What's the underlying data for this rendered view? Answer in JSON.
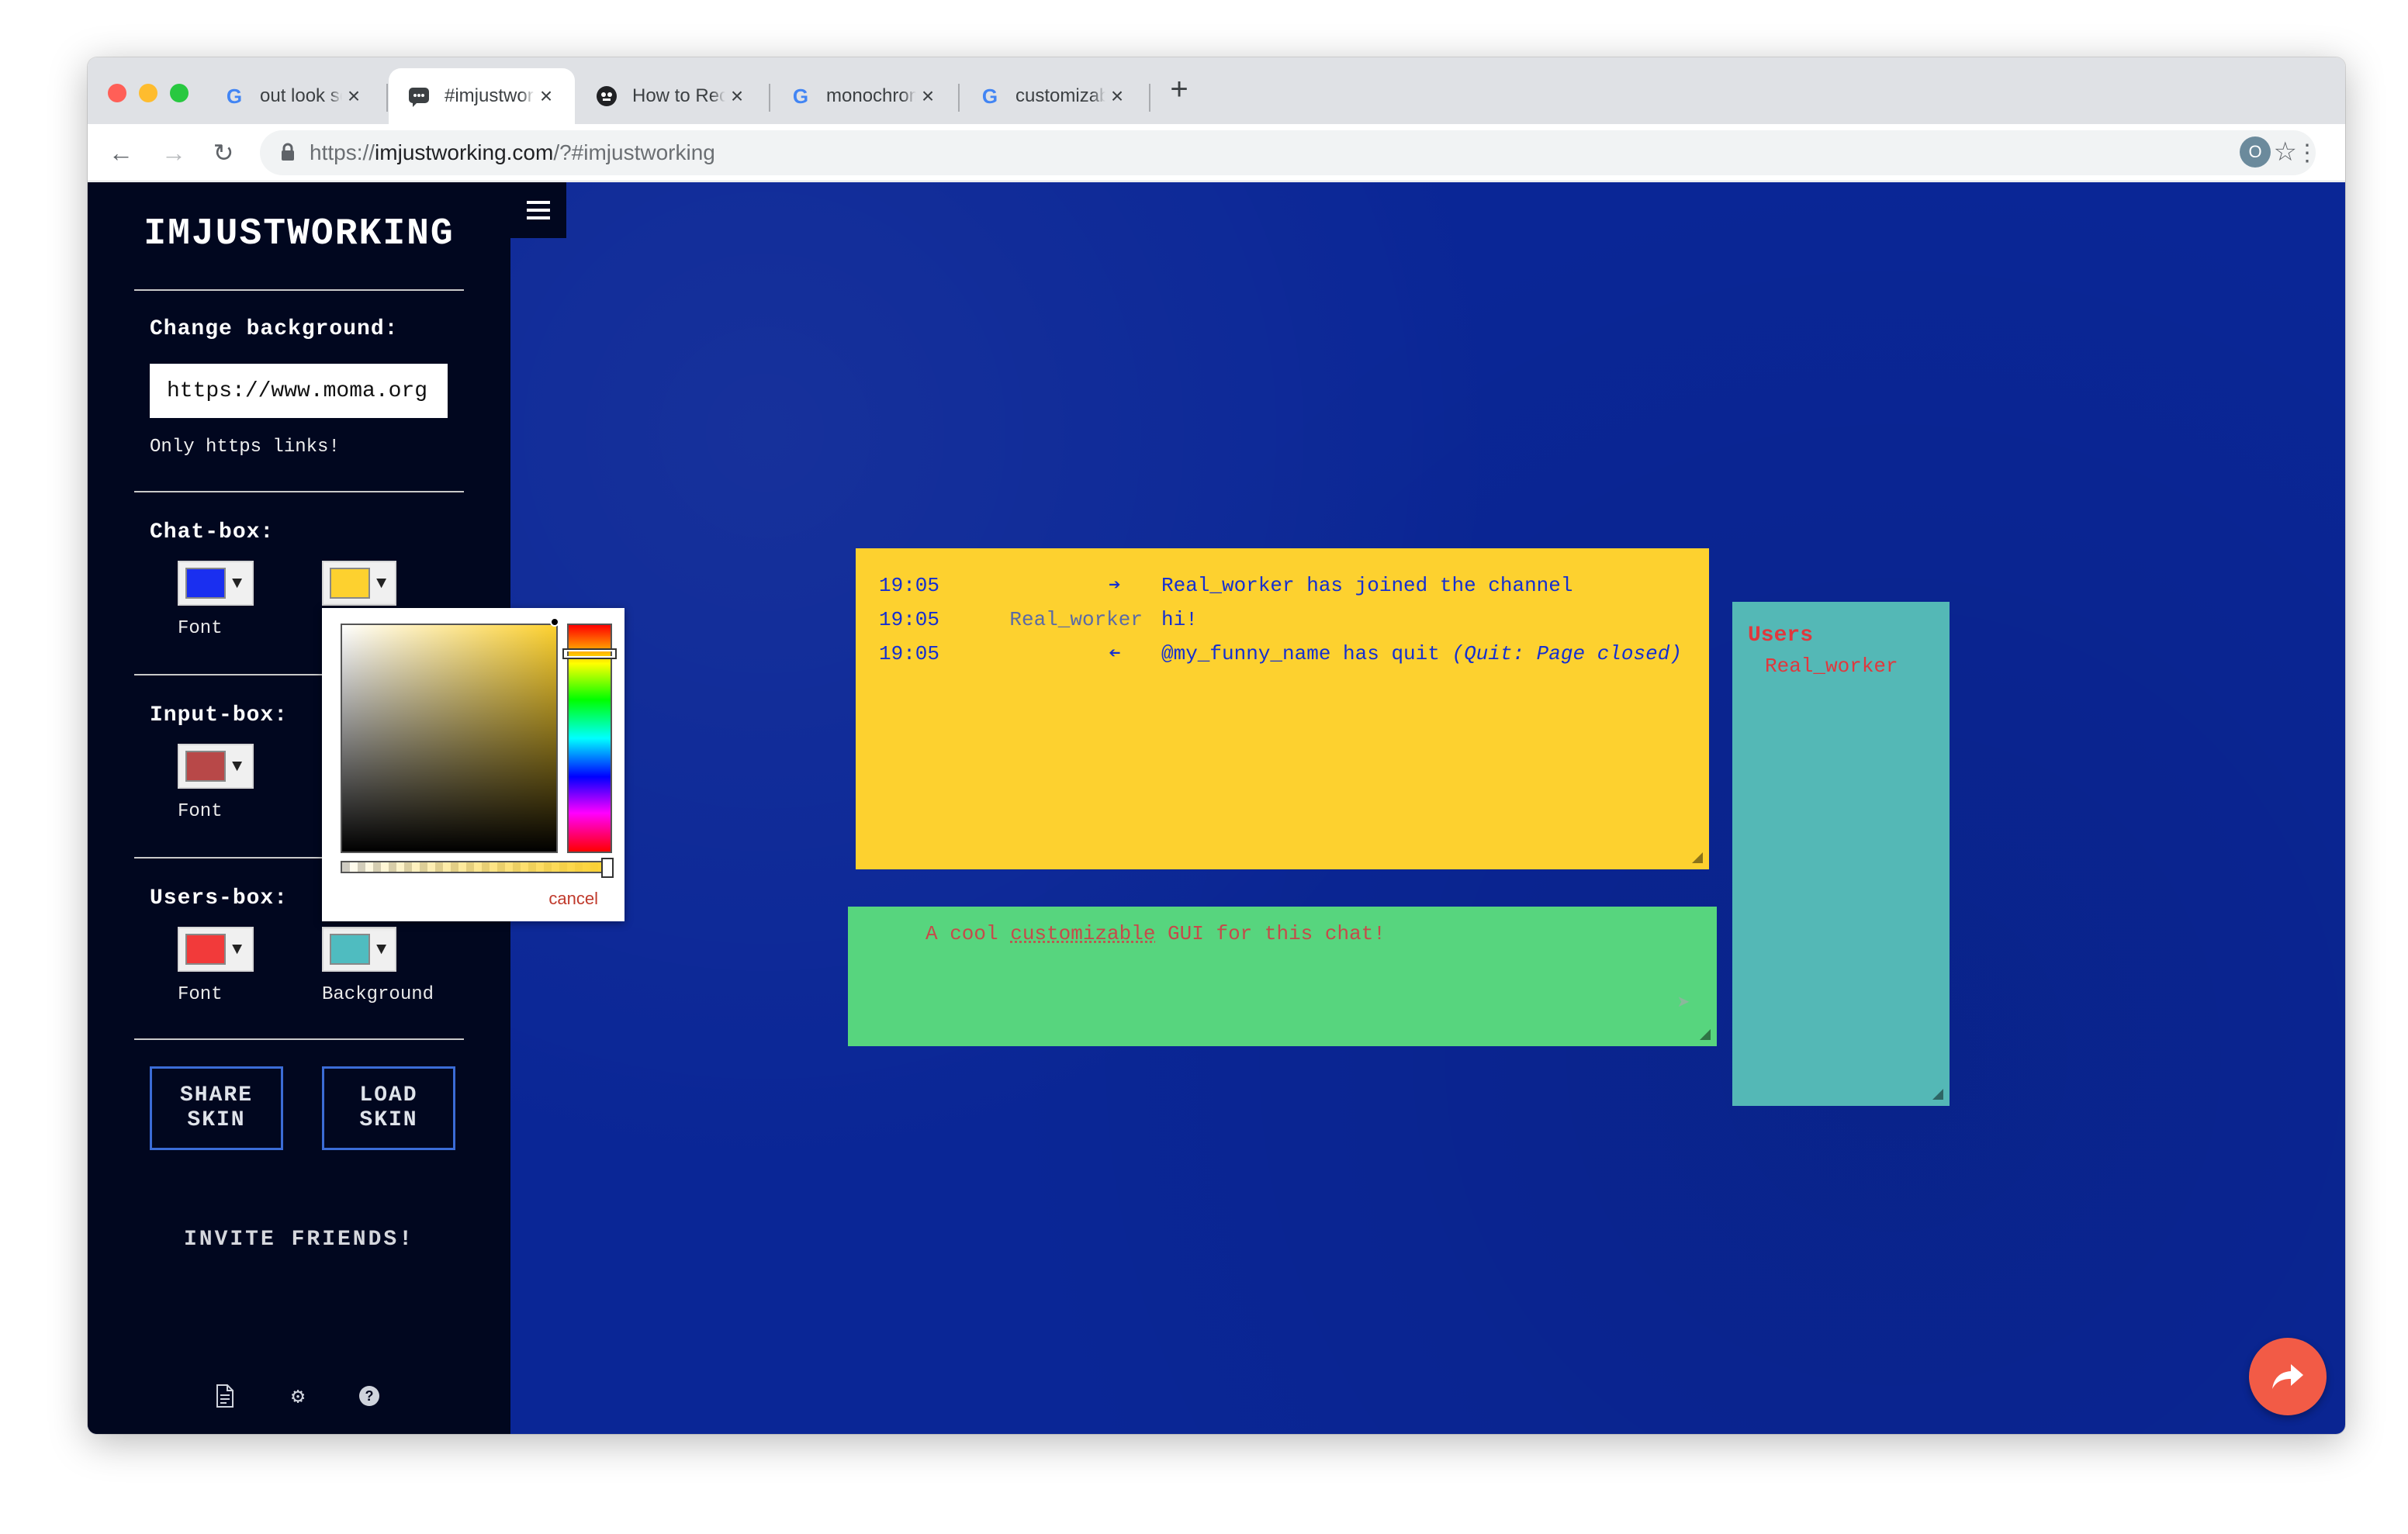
{
  "browser": {
    "tabs": [
      {
        "title": "out look screenshot - Google S",
        "icon": "google-icon"
      },
      {
        "title": "#imjustworking — Imjustworkin",
        "icon": "chat-icon"
      },
      {
        "title": "How to Record Screen in macO",
        "icon": "site-icon"
      },
      {
        "title": "monochrome blue - Google Se",
        "icon": "google-icon"
      },
      {
        "title": "customizable - Google Search",
        "icon": "google-icon"
      }
    ],
    "active_tab": 1,
    "url_scheme": "https://",
    "url_host": "imjustworking.com",
    "url_rest": "/?#imjustworking",
    "profile_initial": "O"
  },
  "sidebar": {
    "brand": "IMJUSTWORKING",
    "change_bg_label": "Change background:",
    "bg_input_value": "https://www.moma.org",
    "bg_hint": "Only https links!",
    "chatbox_label": "Chat-box:",
    "chatbox_font_label": "Font",
    "chatbox_font_color": "#1a2ff0",
    "chatbox_bg_color": "#fdd12f",
    "inputbox_label": "Input-box:",
    "inputbox_font_label": "Font",
    "inputbox_font_color": "#b84848",
    "usersbox_label": "Users-box:",
    "usersbox_font_label": "Font",
    "usersbox_bg_label": "Background",
    "usersbox_font_color": "#f23a3a",
    "usersbox_bg_color": "#4fbcc0",
    "share_skin": "SHARE SKIN",
    "load_skin": "LOAD SKIN",
    "invite": "INVITE FRIENDS!"
  },
  "color_picker": {
    "cancel": "cancel",
    "current_color": "#fdd12f"
  },
  "chat": {
    "messages": [
      {
        "time": "19:05",
        "nick": "",
        "icon": "join-icon",
        "text": "Real_worker has joined the channel",
        "note": ""
      },
      {
        "time": "19:05",
        "nick": "Real_worker",
        "icon": "",
        "text": "hi!",
        "note": ""
      },
      {
        "time": "19:05",
        "nick": "",
        "icon": "quit-icon",
        "text": "@my_funny_name has quit ",
        "note": "(Quit: Page closed)"
      }
    ],
    "input_value_pre": "A cool ",
    "input_value_spell": "customizable",
    "input_value_post": " GUI for this chat!",
    "users_title": "Users",
    "users": [
      "Real_worker"
    ]
  }
}
